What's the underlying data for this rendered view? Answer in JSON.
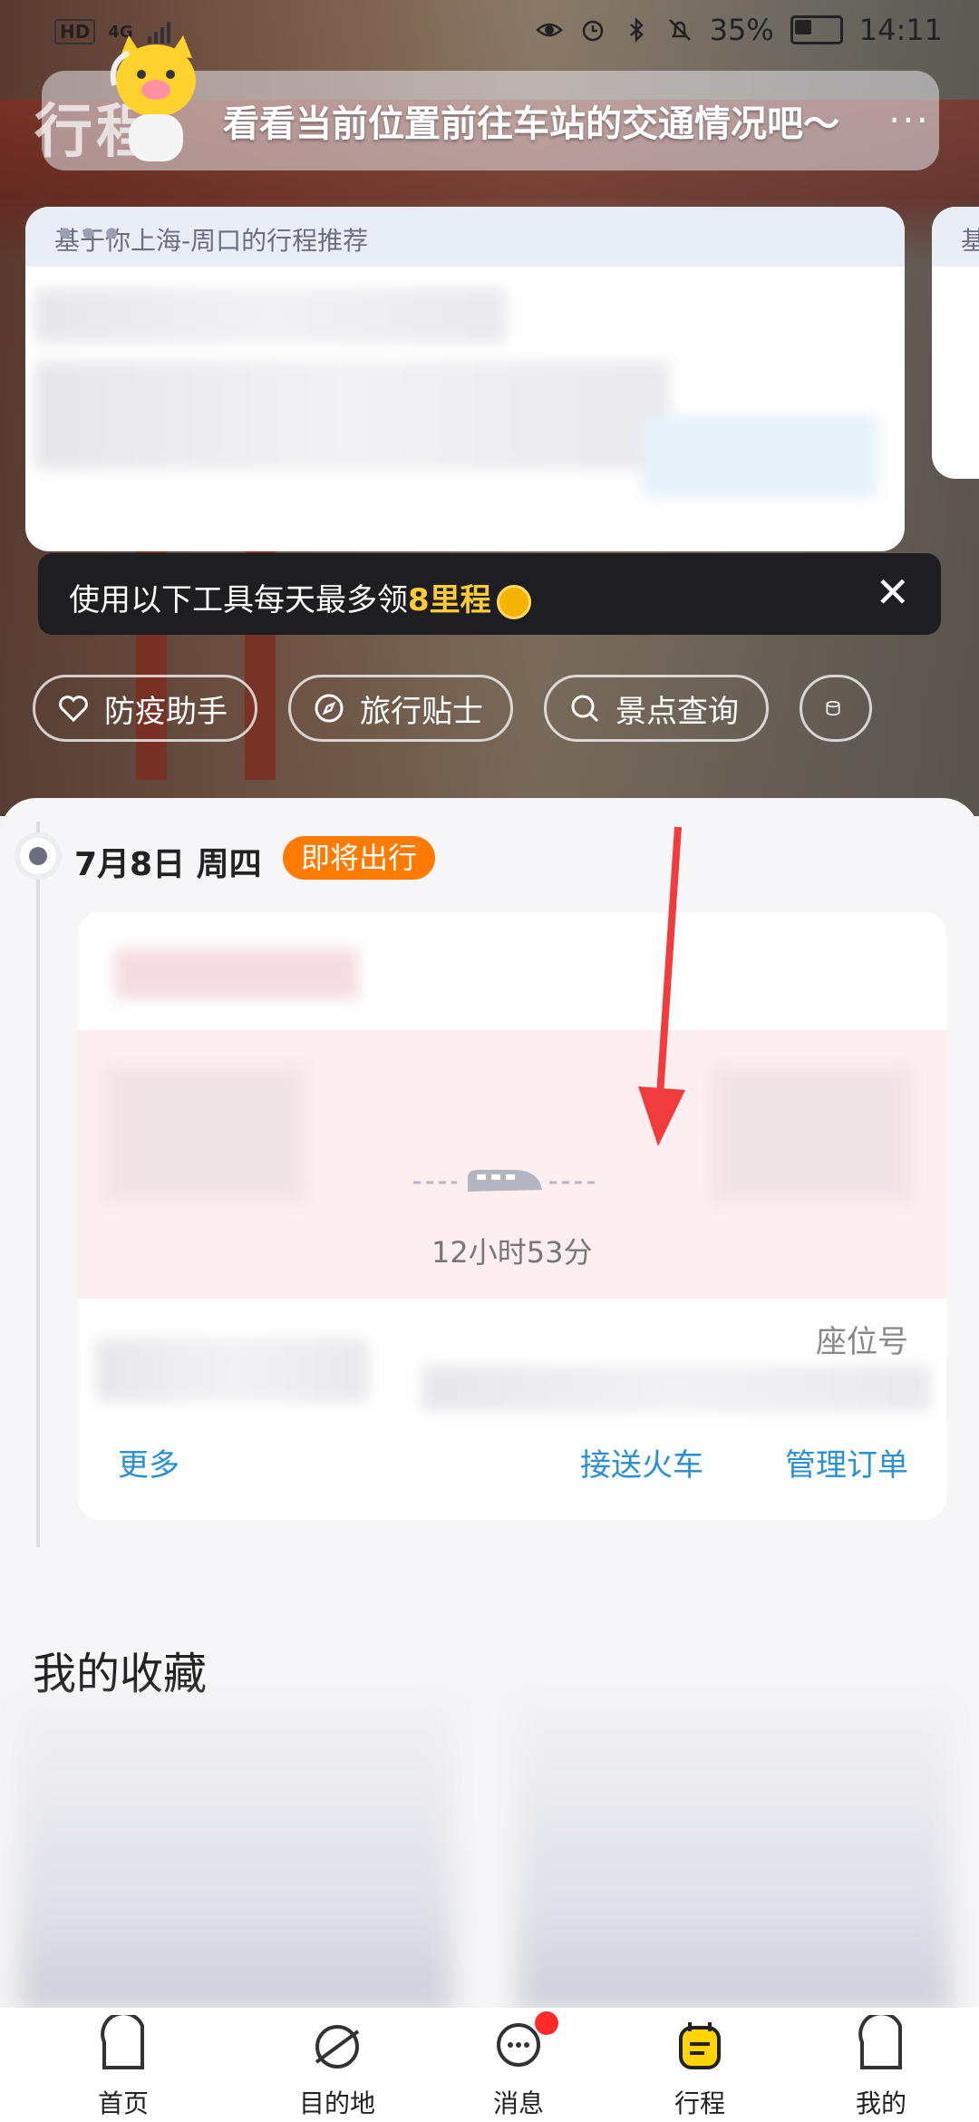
{
  "status_bar": {
    "signal_label": "HD",
    "network": "4G",
    "battery_percent": "35%",
    "time": "14:11"
  },
  "banner": {
    "ghost_title": "行程",
    "message": "看看当前位置前往车站的交通情况吧～",
    "more": "···"
  },
  "recommendation": {
    "header": "基于你上海-周口的行程推荐",
    "more": "•••",
    "second_card_header": "基"
  },
  "tip": {
    "prefix": "使用以下工具每天最多领",
    "highlight": "8里程",
    "close": "✕"
  },
  "chips": [
    {
      "label": "防疫助手",
      "icon": "heart-icon"
    },
    {
      "label": "旅行贴士",
      "icon": "compass-icon"
    },
    {
      "label": "景点查询",
      "icon": "search-icon"
    }
  ],
  "itinerary": {
    "date": "7月8日 周四",
    "status_badge": "即将出行",
    "duration": "12小时53分",
    "seat_label": "座位号",
    "actions": {
      "more": "更多",
      "pickup": "接送火车",
      "manage": "管理订单"
    }
  },
  "favorites": {
    "title": "我的收藏"
  },
  "tabbar": [
    {
      "label": "首页",
      "icon": "home-icon"
    },
    {
      "label": "目的地",
      "icon": "planet-icon"
    },
    {
      "label": "消息",
      "icon": "message-icon"
    },
    {
      "label": "行程",
      "icon": "itinerary-icon",
      "active": true
    },
    {
      "label": "我的",
      "icon": "profile-icon"
    }
  ],
  "colors": {
    "accent": "#ff7a00",
    "link": "#2b8fd1",
    "highlight": "#ffcc33",
    "active_tab": "#ffd400"
  }
}
